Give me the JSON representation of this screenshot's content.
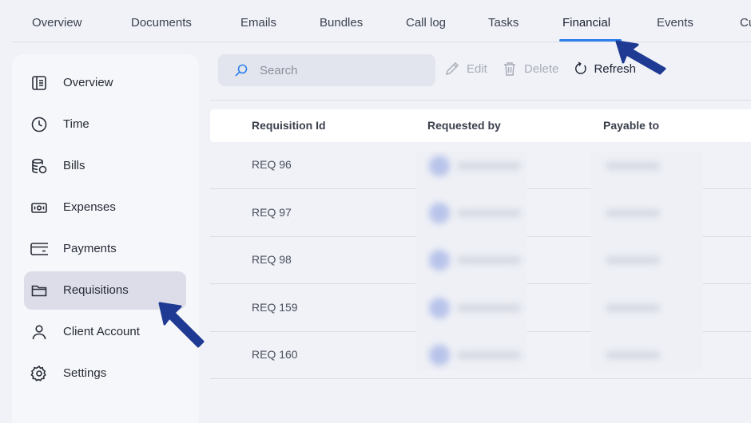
{
  "tabs": [
    {
      "label": "Overview",
      "active": false
    },
    {
      "label": "Documents",
      "active": false
    },
    {
      "label": "Emails",
      "active": false
    },
    {
      "label": "Bundles",
      "active": false
    },
    {
      "label": "Call log",
      "active": false
    },
    {
      "label": "Tasks",
      "active": false
    },
    {
      "label": "Financial",
      "active": true
    },
    {
      "label": "Events",
      "active": false
    },
    {
      "label": "Cu",
      "active": false
    }
  ],
  "sidebar": {
    "items": [
      {
        "label": "Overview",
        "icon": "overview-icon",
        "active": false
      },
      {
        "label": "Time",
        "icon": "clock-icon",
        "active": false
      },
      {
        "label": "Bills",
        "icon": "coins-icon",
        "active": false
      },
      {
        "label": "Expenses",
        "icon": "cash-icon",
        "active": false
      },
      {
        "label": "Payments",
        "icon": "card-icon",
        "active": false
      },
      {
        "label": "Requisitions",
        "icon": "folder-icon",
        "active": true
      },
      {
        "label": "Client Account",
        "icon": "user-icon",
        "active": false
      },
      {
        "label": "Settings",
        "icon": "gear-icon",
        "active": false
      }
    ]
  },
  "toolbar": {
    "search_placeholder": "Search",
    "edit_label": "Edit",
    "delete_label": "Delete",
    "refresh_label": "Refresh"
  },
  "table": {
    "columns": [
      "Requisition Id",
      "Requested by",
      "Payable to"
    ],
    "rows": [
      {
        "id": "REQ 96"
      },
      {
        "id": "REQ 97"
      },
      {
        "id": "REQ 98"
      },
      {
        "id": "REQ 159"
      },
      {
        "id": "REQ 160"
      }
    ]
  },
  "colors": {
    "accent": "#2f80ed",
    "annotation_arrow": "#1f3a93",
    "active_sidebar": "#dcdde8"
  }
}
